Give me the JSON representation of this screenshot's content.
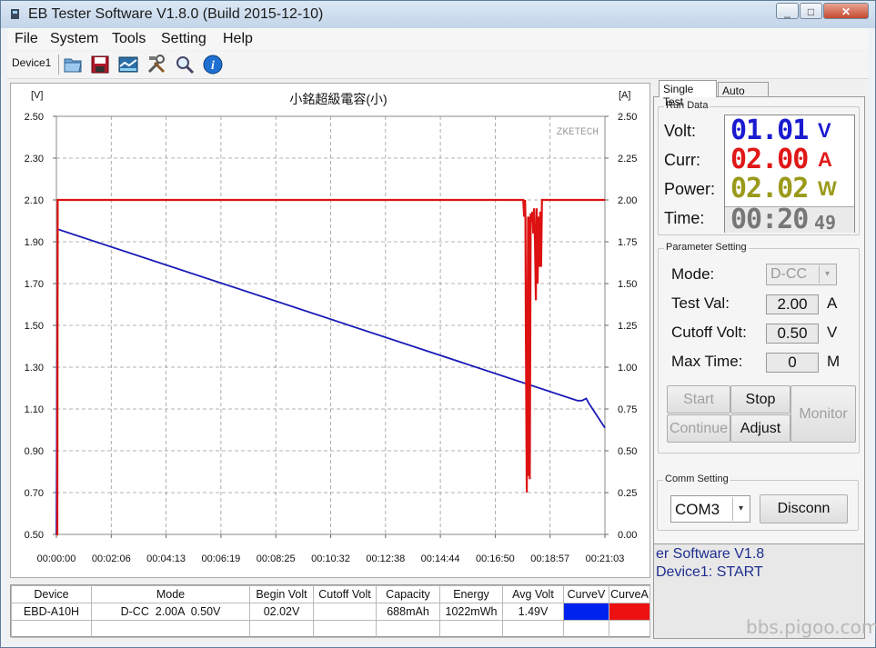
{
  "window": {
    "title": "EB Tester Software V1.8.0 (Build 2015-12-10)"
  },
  "menu": [
    "File",
    "System",
    "Tools",
    "Setting",
    "Help"
  ],
  "toolbar": {
    "device_tab": "Device1"
  },
  "chart_data": {
    "type": "line",
    "title": "小銘超級電容(小)",
    "watermark": "ZKETECH",
    "left_axis_unit": "[V]",
    "right_axis_unit": "[A]",
    "x_ticks": [
      "00:00:00",
      "00:02:06",
      "00:04:13",
      "00:06:19",
      "00:08:25",
      "00:10:32",
      "00:12:38",
      "00:14:44",
      "00:16:50",
      "00:18:57",
      "00:21:03"
    ],
    "y_left_ticks": [
      "2.50",
      "2.30",
      "2.10",
      "1.90",
      "1.70",
      "1.50",
      "1.30",
      "1.10",
      "0.90",
      "0.70",
      "0.50"
    ],
    "y_right_ticks": [
      "2.50",
      "2.25",
      "2.00",
      "1.75",
      "1.50",
      "1.25",
      "1.00",
      "0.75",
      "0.50",
      "0.25",
      "0.00"
    ],
    "ylim_left": [
      0.5,
      2.5
    ],
    "ylim_right": [
      0,
      2.5
    ],
    "x_range_seconds": [
      0,
      1263
    ],
    "grid": true,
    "series": [
      {
        "axis": "left",
        "color": "#1a1ab8",
        "x": [
          0,
          3,
          1200,
          1210,
          1220,
          1225,
          1263
        ],
        "y": [
          0.5,
          1.96,
          1.14,
          1.14,
          1.15,
          1.13,
          1.01
        ]
      },
      {
        "axis": "right",
        "color": "#dd1111",
        "x": [
          0,
          2,
          3,
          1075,
          1077,
          1079,
          1080,
          1081,
          1083,
          1086,
          1088,
          1089,
          1090,
          1092,
          1094,
          1096,
          1098,
          1100,
          1102,
          1104,
          1106,
          1108,
          1110,
          1112,
          1114,
          1116,
          1118,
          1120,
          1122,
          1263
        ],
        "y": [
          0.0,
          0.0,
          2.0,
          2.0,
          1.9,
          2.0,
          1.9,
          1.2,
          0.25,
          1.9,
          0.35,
          1.9,
          0.33,
          1.92,
          1.87,
          1.93,
          1.8,
          1.95,
          1.75,
          1.4,
          1.95,
          1.5,
          1.9,
          1.6,
          1.93,
          1.6,
          2.0,
          2.0,
          2.0,
          2.0
        ]
      }
    ]
  },
  "result_table": {
    "columns": [
      "Device",
      "Mode",
      "Begin Volt",
      "Cutoff Volt",
      "Capacity",
      "Energy",
      "Avg Volt",
      "CurveV",
      "CurveA"
    ],
    "row": [
      "EBD-A10H",
      "D-CC  2.00A  0.50V",
      "02.02V",
      "",
      "688mAh",
      "1022mWh",
      "1.49V",
      "",
      ""
    ],
    "curve_v_color": "#0022ee",
    "curve_a_color": "#ee1111"
  },
  "tabs": {
    "single": "Single Test",
    "auto": "Auto Test"
  },
  "run_data": {
    "group_label": "Run Data",
    "volt_label": "Volt:",
    "volt_value": "01.01",
    "volt_unit": "V",
    "curr_label": "Curr:",
    "curr_value": "02.00",
    "curr_unit": "A",
    "power_label": "Power:",
    "power_value": "02.02",
    "power_unit": "W",
    "time_label": "Time:",
    "time_value": "00:20",
    "time_seconds": "49",
    "volt_color": "#1a1ad0",
    "curr_color": "#e01818",
    "power_color": "#9a9a1a"
  },
  "parameter": {
    "group_label": "Parameter Setting",
    "mode_label": "Mode:",
    "mode_value": "D-CC",
    "test_label": "Test Val:",
    "test_value": "2.00",
    "test_unit": "A",
    "cutoff_label": "Cutoff Volt:",
    "cutoff_value": "0.50",
    "cutoff_unit": "V",
    "maxtime_label": "Max Time:",
    "maxtime_value": "0",
    "maxtime_unit": "M"
  },
  "buttons": {
    "start": "Start",
    "stop": "Stop",
    "monitor": "Monitor",
    "continue": "Continue",
    "adjust": "Adjust"
  },
  "comm": {
    "group_label": "Comm Setting",
    "port": "COM3",
    "disconnect": "Disconn"
  },
  "log": [
    "er Software V1.8",
    "Device1: START"
  ],
  "watermark": "bbs.pigoo.com"
}
